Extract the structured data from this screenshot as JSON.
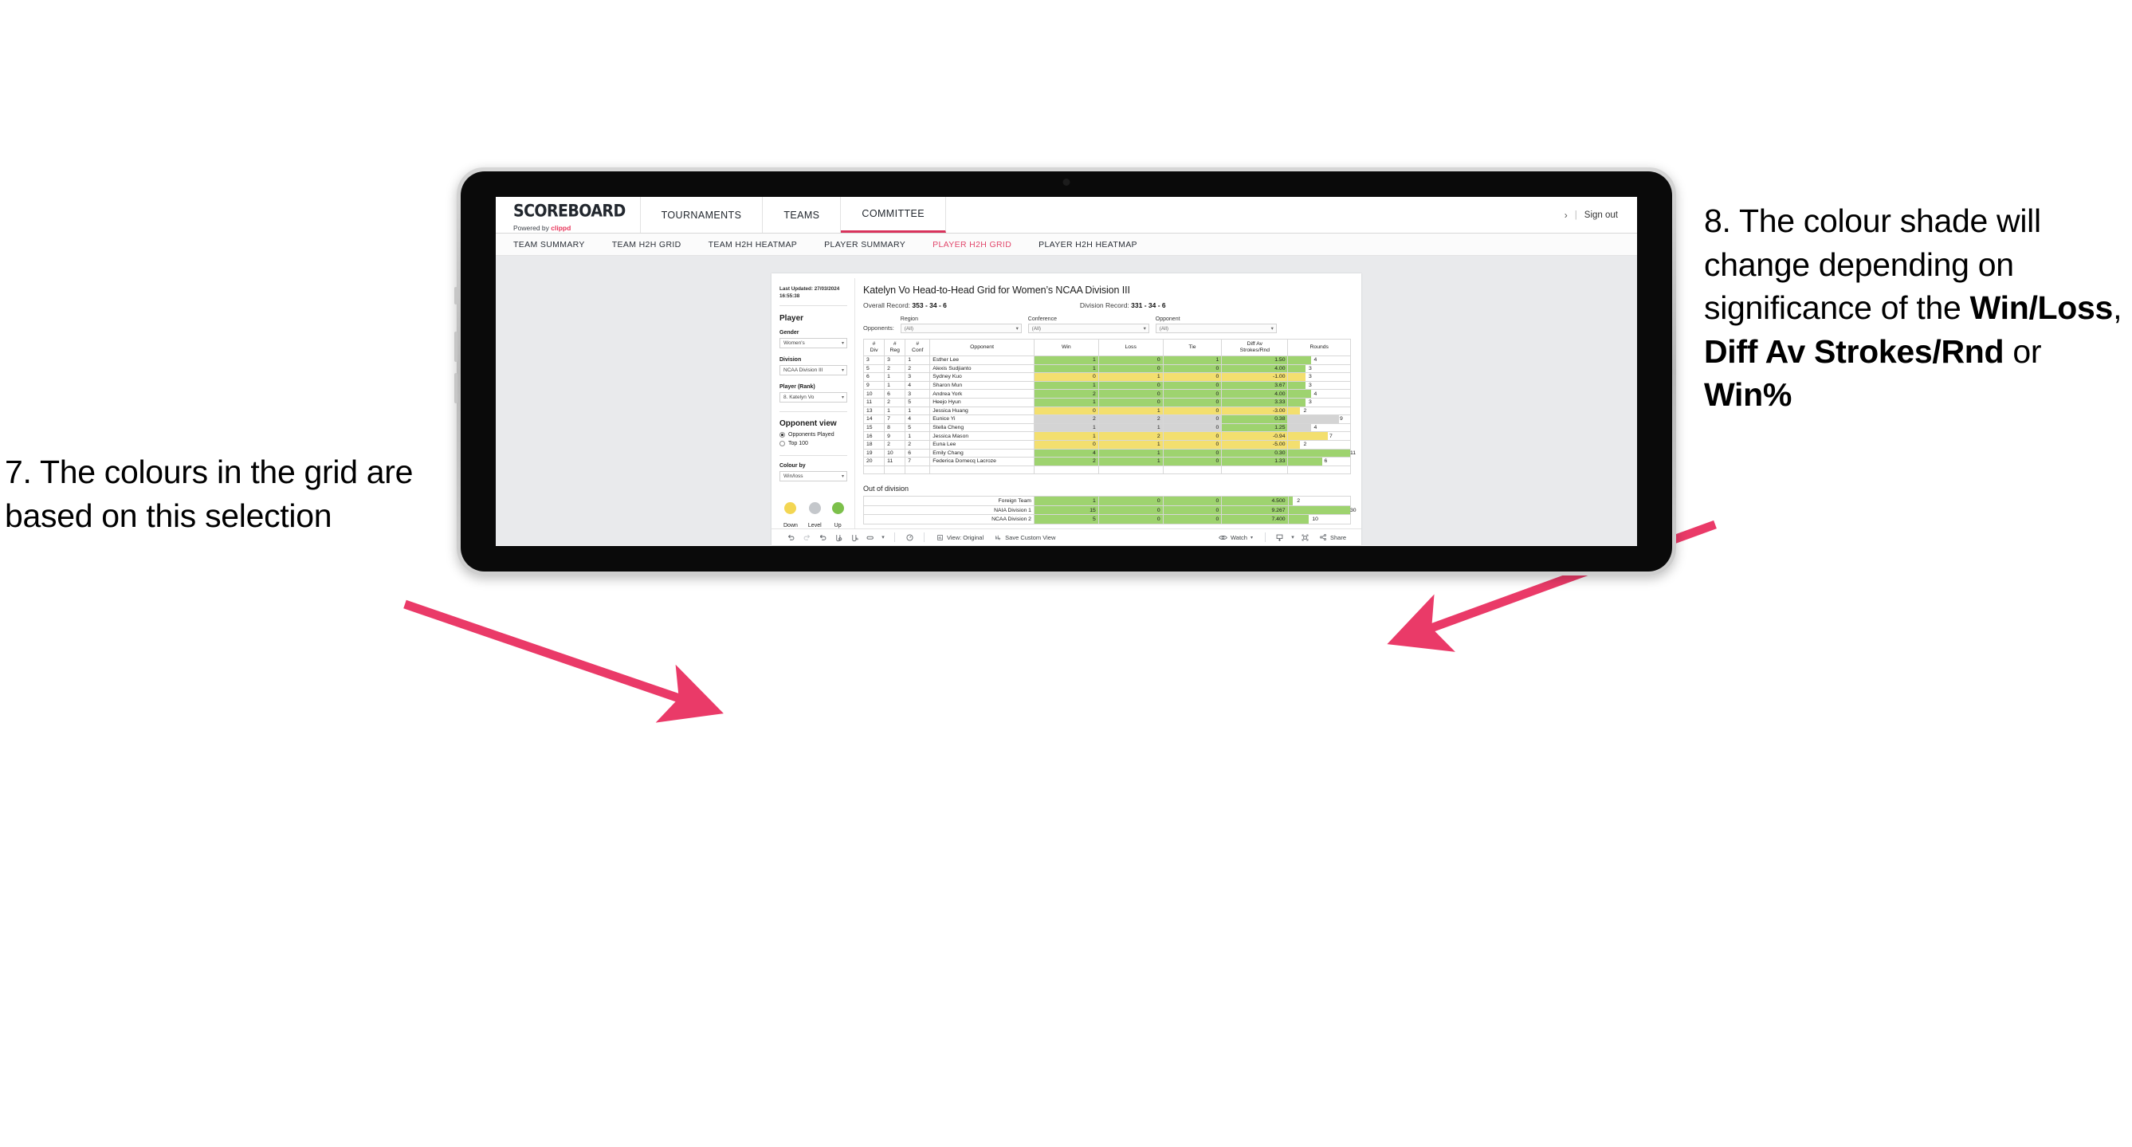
{
  "annotations": {
    "left": "7. The colours in the grid are based on this selection",
    "right_pre": "8. The colour shade will change depending on significance of the ",
    "right_b1": "Win/Loss",
    "right_mid1": ", ",
    "right_b2": "Diff Av Strokes/Rnd",
    "right_mid2": " or ",
    "right_b3": "Win%",
    "arrow_color": "#ea3a68"
  },
  "header": {
    "logo_main": "SCOREBOARD",
    "logo_sub_pre": "Powered by ",
    "logo_sub_brand": "clippd",
    "tabs": [
      {
        "label": "TOURNAMENTS",
        "active": false
      },
      {
        "label": "TEAMS",
        "active": false
      },
      {
        "label": "COMMITTEE",
        "active": true
      }
    ],
    "chevron": "›",
    "separator": "|",
    "sign_out": "Sign out"
  },
  "subnav": {
    "tabs": [
      {
        "label": "TEAM SUMMARY",
        "active": false
      },
      {
        "label": "TEAM H2H GRID",
        "active": false
      },
      {
        "label": "TEAM H2H HEATMAP",
        "active": false
      },
      {
        "label": "PLAYER SUMMARY",
        "active": false
      },
      {
        "label": "PLAYER H2H GRID",
        "active": true
      },
      {
        "label": "PLAYER H2H HEATMAP",
        "active": false
      }
    ]
  },
  "filters": {
    "last_updated_line1": "Last Updated: 27/03/2024",
    "last_updated_line2": "16:55:38",
    "player_title": "Player",
    "gender_label": "Gender",
    "gender_value": "Women's",
    "division_label": "Division",
    "division_value": "NCAA Division III",
    "player_rank_label": "Player (Rank)",
    "player_rank_value": "8. Katelyn Vo",
    "opponent_view_title": "Opponent view",
    "opponent_view_options": [
      {
        "label": "Opponents Played",
        "selected": true
      },
      {
        "label": "Top 100",
        "selected": false
      }
    ],
    "colour_by_label": "Colour by",
    "colour_by_value": "Win/loss",
    "legend": [
      {
        "label": "Down",
        "color": "#f3d653"
      },
      {
        "label": "Level",
        "color": "#c4c7cb"
      },
      {
        "label": "Up",
        "color": "#7cc04b"
      }
    ]
  },
  "main": {
    "title": "Katelyn Vo Head-to-Head Grid for Women’s NCAA Division III",
    "overall_record_label": "Overall Record: ",
    "overall_record_value": "353 -  34 - 6",
    "division_record_label": "Division Record: ",
    "division_record_value": "331 -  34 - 6",
    "opponents_label": "Opponents:",
    "opponent_filters": [
      {
        "label": "Region",
        "value": "(All)"
      },
      {
        "label": "Conference",
        "value": "(All)"
      },
      {
        "label": "Opponent",
        "value": "(All)"
      }
    ]
  },
  "chart_data": {
    "type": "table",
    "title": "Katelyn Vo Head-to-Head Grid for Women’s NCAA Division III",
    "columns": [
      "# Div",
      "# Reg",
      "# Conf",
      "Opponent",
      "Win",
      "Loss",
      "Tie",
      "Diff Av Strokes/Rnd",
      "Rounds"
    ],
    "column_headers_multiline": [
      [
        "#",
        "Div"
      ],
      [
        "#",
        "Reg"
      ],
      [
        "#",
        "Conf"
      ],
      [
        "Opponent"
      ],
      [
        "Win"
      ],
      [
        "Loss"
      ],
      [
        "Tie"
      ],
      [
        "Diff Av",
        "Strokes/Rnd"
      ],
      [
        "Rounds"
      ]
    ],
    "rounds_max": 11,
    "rows": [
      {
        "div": "3",
        "reg": "3",
        "conf": "1",
        "opponent": "Esther Lee",
        "win": "1",
        "loss": "0",
        "tie": "1",
        "diff": "1.50",
        "rounds": "4",
        "color": "green"
      },
      {
        "div": "5",
        "reg": "2",
        "conf": "2",
        "opponent": "Alexis Sudjianto",
        "win": "1",
        "loss": "0",
        "tie": "0",
        "diff": "4.00",
        "rounds": "3",
        "color": "green"
      },
      {
        "div": "6",
        "reg": "1",
        "conf": "3",
        "opponent": "Sydney Kuo",
        "win": "0",
        "loss": "1",
        "tie": "0",
        "diff": "-1.00",
        "rounds": "3",
        "color": "yellow"
      },
      {
        "div": "9",
        "reg": "1",
        "conf": "4",
        "opponent": "Sharon Mun",
        "win": "1",
        "loss": "0",
        "tie": "0",
        "diff": "3.67",
        "rounds": "3",
        "color": "green"
      },
      {
        "div": "10",
        "reg": "6",
        "conf": "3",
        "opponent": "Andrea York",
        "win": "2",
        "loss": "0",
        "tie": "0",
        "diff": "4.00",
        "rounds": "4",
        "color": "green"
      },
      {
        "div": "11",
        "reg": "2",
        "conf": "5",
        "opponent": "Heejo Hyun",
        "win": "1",
        "loss": "0",
        "tie": "0",
        "diff": "3.33",
        "rounds": "3",
        "color": "green"
      },
      {
        "div": "13",
        "reg": "1",
        "conf": "1",
        "opponent": "Jessica Huang",
        "win": "0",
        "loss": "1",
        "tie": "0",
        "diff": "-3.00",
        "rounds": "2",
        "color": "yellow"
      },
      {
        "div": "14",
        "reg": "7",
        "conf": "4",
        "opponent": "Eunice Yi",
        "win": "2",
        "loss": "2",
        "tie": "0",
        "diff": "0.38",
        "rounds": "9",
        "color": "neutral",
        "diff_color": "green"
      },
      {
        "div": "15",
        "reg": "8",
        "conf": "5",
        "opponent": "Stella Cheng",
        "win": "1",
        "loss": "1",
        "tie": "0",
        "diff": "1.25",
        "rounds": "4",
        "color": "neutral",
        "diff_color": "green"
      },
      {
        "div": "16",
        "reg": "9",
        "conf": "1",
        "opponent": "Jessica Mason",
        "win": "1",
        "loss": "2",
        "tie": "0",
        "diff": "-0.94",
        "rounds": "7",
        "color": "yellow"
      },
      {
        "div": "18",
        "reg": "2",
        "conf": "2",
        "opponent": "Euna Lee",
        "win": "0",
        "loss": "1",
        "tie": "0",
        "diff": "-5.00",
        "rounds": "2",
        "color": "yellow"
      },
      {
        "div": "19",
        "reg": "10",
        "conf": "6",
        "opponent": "Emily Chang",
        "win": "4",
        "loss": "1",
        "tie": "0",
        "diff": "0.30",
        "rounds": "11",
        "color": "green"
      },
      {
        "div": "20",
        "reg": "11",
        "conf": "7",
        "opponent": "Federica Domecq Lacroze",
        "win": "2",
        "loss": "1",
        "tie": "0",
        "diff": "1.33",
        "rounds": "6",
        "color": "green"
      }
    ],
    "out_of_division_title": "Out of division",
    "out_of_division": [
      {
        "name": "Foreign Team",
        "win": "1",
        "loss": "0",
        "tie": "0",
        "diff": "4.500",
        "rounds": "2",
        "color": "green"
      },
      {
        "name": "NAIA Division 1",
        "win": "15",
        "loss": "0",
        "tie": "0",
        "diff": "9.267",
        "rounds": "30",
        "color": "green"
      },
      {
        "name": "NCAA Division 2",
        "win": "5",
        "loss": "0",
        "tie": "0",
        "diff": "7.400",
        "rounds": "10",
        "color": "green"
      }
    ],
    "out_of_division_rounds_max": 30,
    "colors": {
      "green": "#9ed36f",
      "yellow": "#f3df6f",
      "neutral": "#d4d4d4"
    }
  },
  "toolbar": {
    "icons": [
      "undo-icon",
      "redo-icon",
      "revert-icon",
      "refresh-icon",
      "pause-icon",
      "view-mode-icon",
      "chevron-down-icon",
      "alerts-icon"
    ],
    "view_label": "View: Original",
    "save_custom_view_label": "Save Custom View",
    "watch_label": "Watch",
    "share_label": "Share"
  }
}
